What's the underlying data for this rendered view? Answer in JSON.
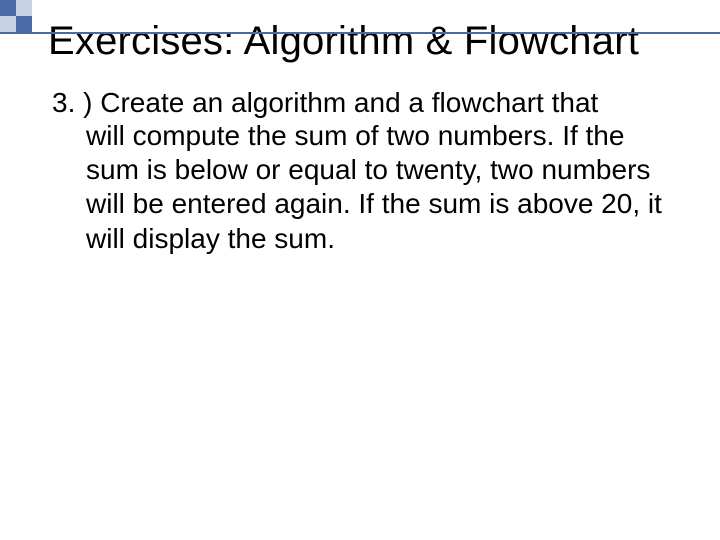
{
  "slide": {
    "title": "Exercises: Algorithm & Flowchart",
    "item_number": "3. )",
    "item_text_first": "Create an algorithm and a flowchart that",
    "item_text_rest": "will compute the sum of two numbers. If the sum is below or equal to twenty, two numbers will be entered again. If the sum is above 20, it will display the sum."
  }
}
